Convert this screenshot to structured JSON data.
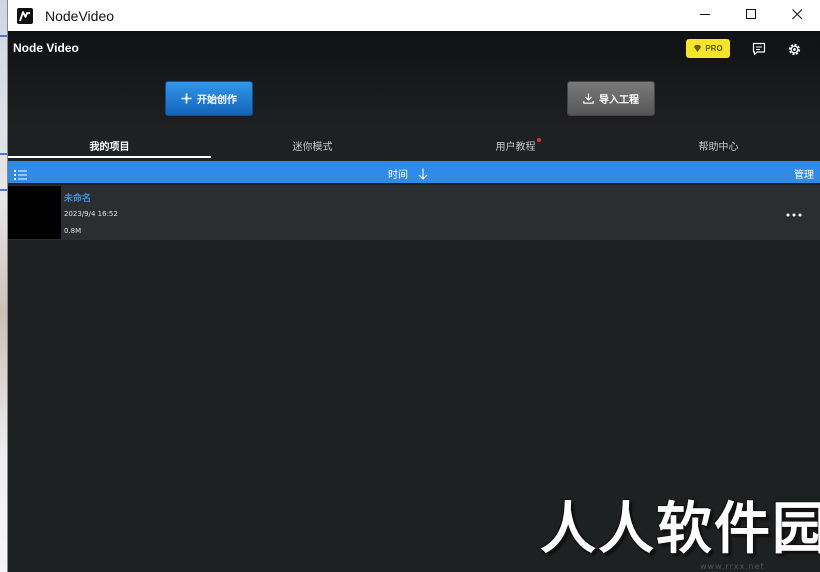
{
  "window": {
    "title": "NodeVideo",
    "controls": {
      "minimize": "minimize-icon",
      "maximize": "maximize-icon",
      "close": "close-icon"
    }
  },
  "header": {
    "brand": "Node Video",
    "pro_badge": "PRO",
    "create_button": "开始创作",
    "import_button": "导入工程"
  },
  "tabs": [
    {
      "label": "我的项目",
      "active": true
    },
    {
      "label": "迷你模式",
      "active": false
    },
    {
      "label": "用户教程",
      "active": false,
      "has_notification_dot": true
    },
    {
      "label": "帮助中心",
      "active": false
    }
  ],
  "sortbar": {
    "sort_label": "时间",
    "manage_label": "管理"
  },
  "projects": [
    {
      "name": "未命名",
      "date": "2023/9/4 16:52",
      "size": "0.8M"
    }
  ],
  "watermark": {
    "text": "人人软件园",
    "sub": "www.rrxx.net"
  },
  "colors": {
    "accent": "#2f8be6",
    "pro_badge": "#f4e52a",
    "notification_dot": "#e0332f",
    "background": "#1e2122"
  }
}
